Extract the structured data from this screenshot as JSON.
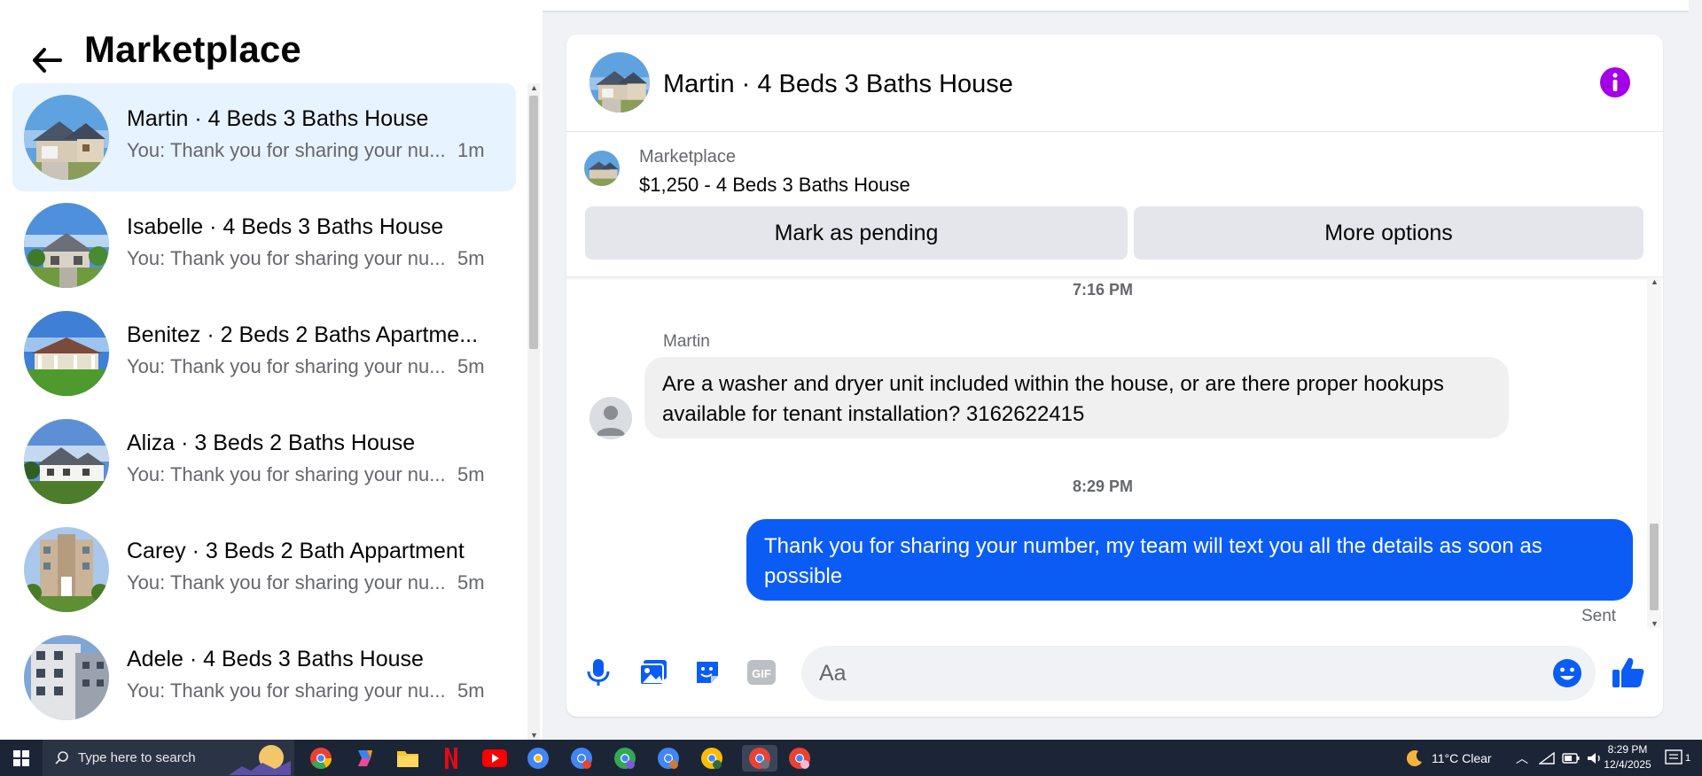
{
  "left": {
    "title": "Marketplace",
    "conversations": [
      {
        "name": "Martin · 4 Beds 3 Baths House",
        "preview": "You: Thank you for sharing your nu...",
        "time": "1m",
        "active": true
      },
      {
        "name": "Isabelle · 4 Beds 3 Baths House",
        "preview": "You: Thank you for sharing your nu...",
        "time": "5m"
      },
      {
        "name": "Benitez · 2 Beds 2 Baths Apartme...",
        "preview": "You: Thank you for sharing your nu...",
        "time": "5m"
      },
      {
        "name": "Aliza · 3 Beds 2 Baths House",
        "preview": "You: Thank you for sharing your nu...",
        "time": "5m"
      },
      {
        "name": "Carey · 3 Beds 2 Bath Appartment",
        "preview": "You: Thank you for sharing your nu...",
        "time": "5m"
      },
      {
        "name": "Adele · 4 Beds 3 Baths House",
        "preview": "You: Thank you for sharing your nu...",
        "time": "5m"
      }
    ]
  },
  "chat": {
    "title": "Martin · 4 Beds 3 Baths House",
    "listing": {
      "source": "Marketplace",
      "price_title": "$1,250 - 4 Beds 3 Baths House",
      "pending_label": "Mark as pending",
      "more_label": "More options"
    },
    "messages": {
      "time1": "7:16 PM",
      "sender": "Martin",
      "incoming": "Are a washer and dryer unit included within the house, or are there proper hookups available for tenant installation? 3162622415",
      "time2": "8:29 PM",
      "outgoing": "Thank you for  sharing your number, my team will text you all the details as soon as possible",
      "status": "Sent"
    },
    "composer": {
      "placeholder": "Aa"
    }
  },
  "taskbar": {
    "search_placeholder": "Type here to search",
    "weather": "11°C  Clear",
    "time": "8:29 PM",
    "date": "12/4/2025",
    "notification_count": "1"
  },
  "colors": {
    "accent": "#0a5cf5",
    "info": "#a300e8",
    "active_row": "#e7f3ff"
  }
}
